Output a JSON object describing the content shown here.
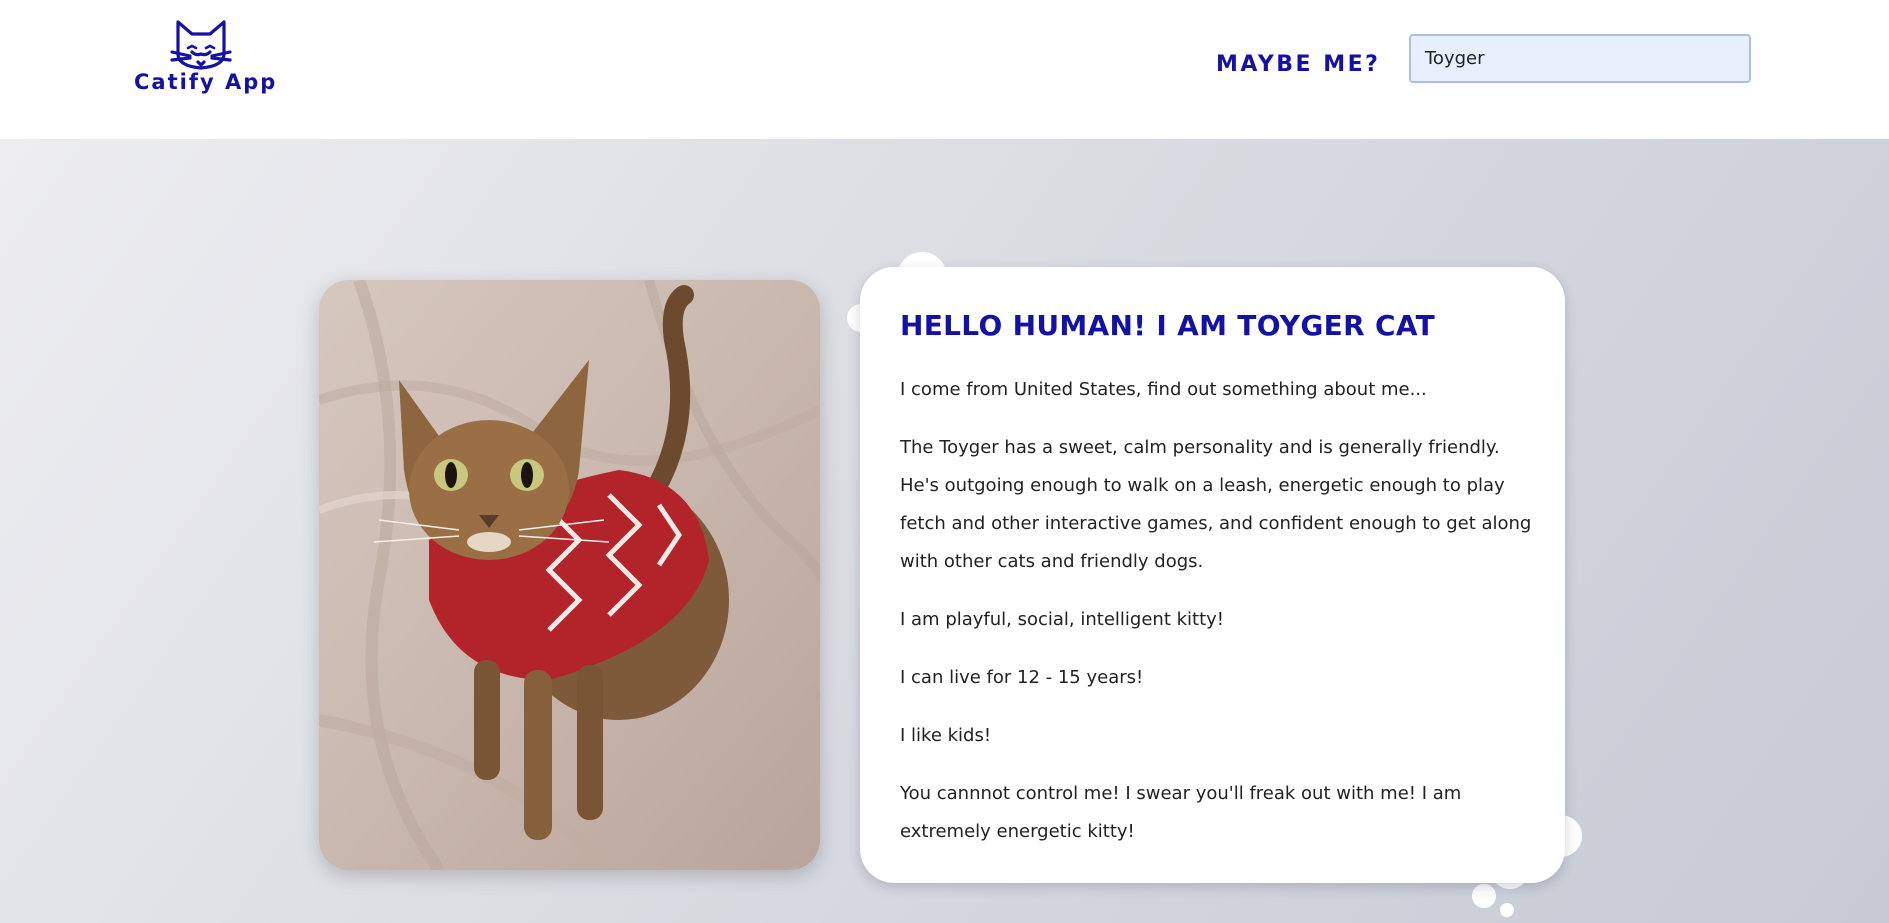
{
  "header": {
    "logo_text": "Catify App",
    "nav_label": "MAYBE ME?",
    "search_value": "Toyger"
  },
  "icons": {
    "logo": "cat-head-icon"
  },
  "hero": {
    "photo": "cat-photo",
    "card": {
      "title": "HELLO HUMAN! I AM TOYGER CAT",
      "origin": "I come from United States, find out something about me...",
      "description": "The Toyger has a sweet, calm personality and is generally friendly. He's outgoing enough to walk on a leash, energetic enough to play fetch and other interactive games, and confident enough to get along with other cats and friendly dogs.",
      "temperament": "I am playful, social, intelligent kitty!",
      "lifespan": "I can live for 12 - 15 years!",
      "kids": "I like kids!",
      "energy": "You cannnot control me! I swear you'll freak out with me! I am extremely energetic kitty!"
    }
  },
  "colors": {
    "brand": "#1411a6",
    "search_bg": "#e8f0fd",
    "search_border": "#a9bfe6",
    "text": "#222222"
  }
}
